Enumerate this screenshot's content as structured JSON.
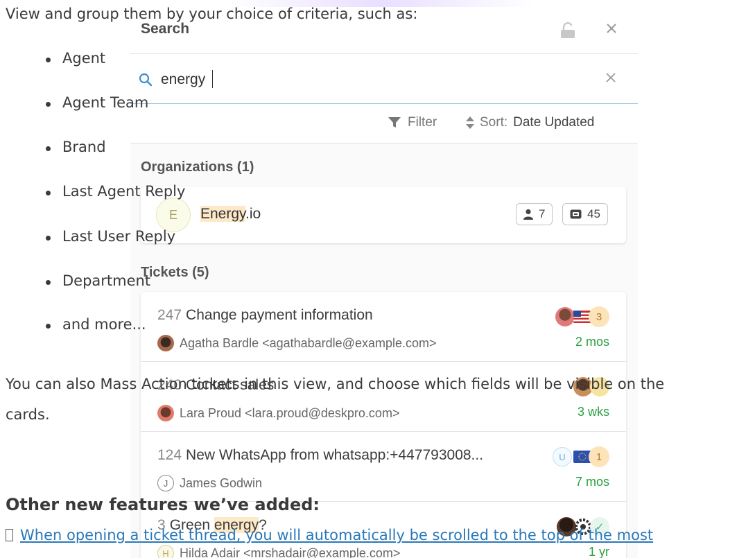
{
  "article": {
    "intro": "View and group them by your choice of criteria, such as:",
    "bullets": [
      "Agent",
      "Agent Team",
      "Brand",
      "Last Agent Reply",
      "Last User Reply",
      "Department",
      "and more..."
    ],
    "mass_action_line1": "You can also Mass Action tickets in this view, and choose which fields will be visible on the",
    "mass_action_line2": "cards.",
    "features_heading": "Other new features we’ve added:",
    "feature_link": "When opening a ticket thread, you will automatically be scrolled to the top of the most"
  },
  "search_panel": {
    "title": "Search",
    "query": "energy",
    "filter_label": "Filter",
    "sort_prefix": "Sort:",
    "sort_value": "Date Updated",
    "organizations_title": "Organizations (1)",
    "organization": {
      "avatar_letter": "E",
      "name_highlight": "Energy",
      "name_rest": ".io",
      "people_count": "7",
      "ticket_count": "45"
    },
    "tickets_title": "Tickets (5)",
    "tickets": [
      {
        "id": "247",
        "title": "Change payment information",
        "person": "Agatha Bardle <agathabardle@example.com>",
        "age": "2 mos",
        "badge": "3"
      },
      {
        "id": "240",
        "title": "Contact sales",
        "person": "Lara Proud <lara.proud@deskpro.com>",
        "age": "3 wks",
        "badge": ""
      },
      {
        "id": "124",
        "title": "New WhatsApp from whatsapp:+447793008...",
        "person": "James Godwin",
        "person_letter": "J",
        "age": "7 mos",
        "badge": "1",
        "badge_u": "U"
      },
      {
        "id": "3",
        "title_pre": "Green ",
        "title_highlight": "energy",
        "title_post": "?",
        "person": "Hilda Adair <mrshadair@example.com>",
        "person_letter": "H",
        "age": "1 yr"
      }
    ]
  },
  "colors": {
    "highlight": "#fde9c8",
    "age_green": "#28a040",
    "link_blue": "#2a78b8",
    "search_blue": "#3a8fd0"
  }
}
